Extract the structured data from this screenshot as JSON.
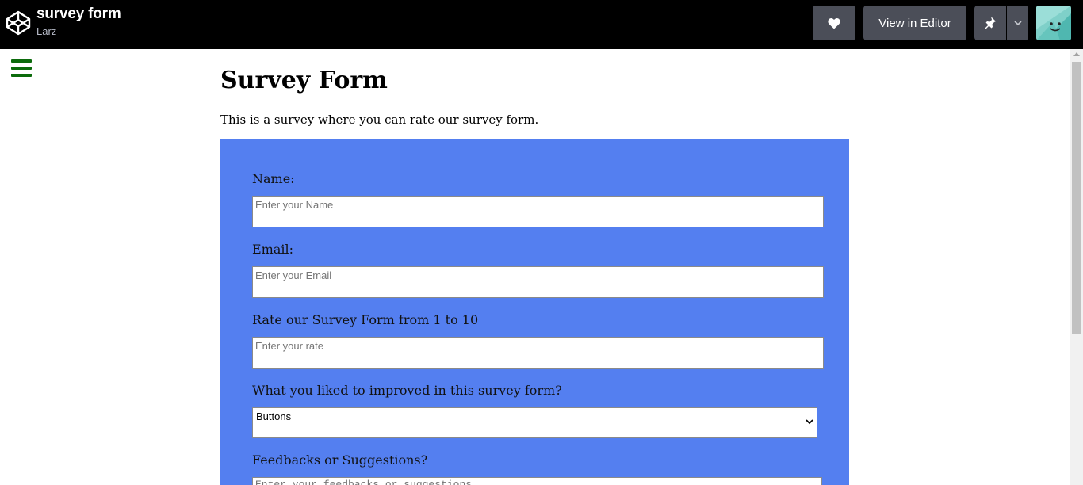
{
  "header": {
    "pen_title": "survey form",
    "author": "Larz",
    "view_in_editor_label": "View in Editor",
    "icons": [
      "codepen-logo-icon",
      "heart-icon",
      "pin-icon",
      "chevron-down-icon",
      "avatar"
    ]
  },
  "page": {
    "title": "Survey Form",
    "description": "This is a survey where you can rate our survey form.",
    "accent_color": "#547ff0",
    "menu_color": "#0c6b0c"
  },
  "form": {
    "name_label": "Name:",
    "name_placeholder": "Enter your Name",
    "email_label": "Email:",
    "email_placeholder": "Enter your Email",
    "rate_label": "Rate our Survey Form from 1 to 10",
    "rate_placeholder": "Enter your rate",
    "improve_label": "What you liked to improved in this survey form?",
    "improve_selected": "Buttons",
    "feedback_label": "Feedbacks or Suggestions?",
    "feedback_placeholder": "Enter your feedbacks or suggestions"
  }
}
